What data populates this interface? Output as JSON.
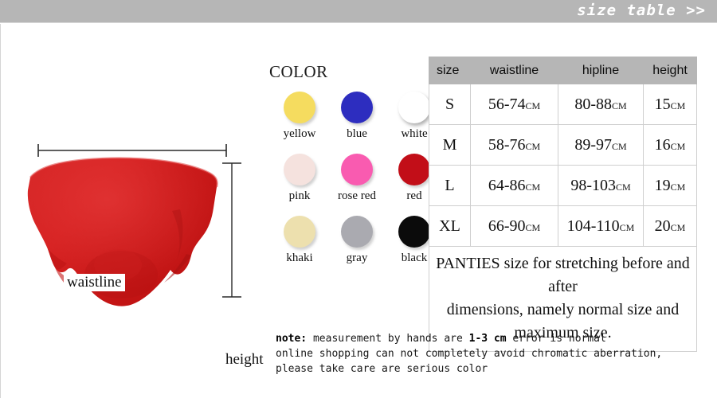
{
  "banner": {
    "text": "size table >>"
  },
  "product": {
    "waistline_label": "waistline",
    "height_label": "height",
    "color_hex": "#CE1B1B"
  },
  "colors": {
    "title": "COLOR",
    "swatches": [
      {
        "name": "yellow",
        "hex": "#F5DC5F"
      },
      {
        "name": "blue",
        "hex": "#2D2DBF"
      },
      {
        "name": "white",
        "hex": "#FFFFFF"
      },
      {
        "name": "pink",
        "hex": "#F5E2DE"
      },
      {
        "name": "rose red",
        "hex": "#F95BB0"
      },
      {
        "name": "red",
        "hex": "#C20E18"
      },
      {
        "name": "khaki",
        "hex": "#EDE0AE"
      },
      {
        "name": "gray",
        "hex": "#AAAAB0"
      },
      {
        "name": "black",
        "hex": "#0B0B0B"
      }
    ]
  },
  "size_table": {
    "headers": [
      "size",
      "waistline",
      "hipline",
      "height"
    ],
    "rows": [
      {
        "size": "S",
        "waistline": "56-74",
        "hipline": "80-88",
        "height": "15"
      },
      {
        "size": "M",
        "waistline": "58-76",
        "hipline": "89-97",
        "height": "16"
      },
      {
        "size": "L",
        "waistline": "64-86",
        "hipline": "98-103",
        "height": "19"
      },
      {
        "size": "XL",
        "waistline": "66-90",
        "hipline": "104-110",
        "height": "20"
      }
    ],
    "unit": "CM",
    "note_line1": "PANTIES size for stretching before and after",
    "note_line2": "dimensions, namely normal size and maximum size."
  },
  "bottom_note": {
    "label": "note:",
    "line1_a": " measurement by hands are ",
    "line1_b": "1-3 cm",
    "line1_c": " error is normal",
    "line2": "online shopping can not completely avoid chromatic aberration,",
    "line3": "please take care are serious color"
  }
}
